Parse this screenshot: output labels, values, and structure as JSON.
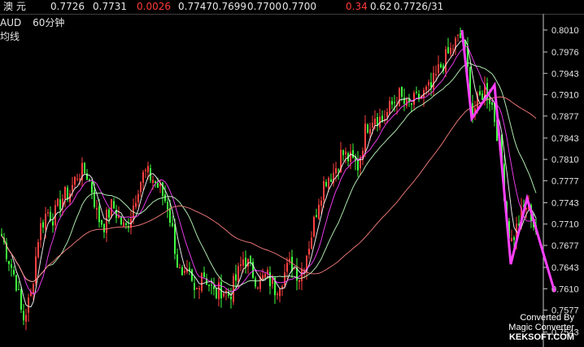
{
  "header": {
    "symbol": "澳  元",
    "quotes": [
      "0.7726",
      "0.7731",
      "0.0026",
      "0.7747",
      "0.7699",
      "0.7700",
      "0.7700",
      "0.34",
      "0.62",
      "0.7726/31"
    ]
  },
  "overlay": {
    "ticker": "AUD",
    "interval": "60分钟",
    "indicator": "均线"
  },
  "watermark": {
    "line1": "Converted By",
    "line2": "Magic Converter",
    "line3": "KEKSOFT.COM"
  },
  "chart_data": {
    "type": "candlestick",
    "y_ticks": [
      "0.8010",
      "0.7976",
      "0.7943",
      "0.7910",
      "0.7877",
      "0.7843",
      "0.7810",
      "0.7777",
      "0.7743",
      "0.7710",
      "0.7677",
      "0.7643",
      "0.7610",
      "0.7577",
      "0.7543"
    ],
    "ylim": [
      0.753,
      0.8025
    ],
    "colors": {
      "up": "#ff4040",
      "down": "#40ff40",
      "ma1": "#ffffff",
      "ma2": "#ff40ff",
      "ma3": "#c0ffc0",
      "ma4": "#ff8080",
      "zigzag": "#ff40ff"
    },
    "close_path": [
      [
        0,
        0.77
      ],
      [
        10,
        0.766
      ],
      [
        20,
        0.762
      ],
      [
        28,
        0.756
      ],
      [
        38,
        0.76
      ],
      [
        48,
        0.77
      ],
      [
        58,
        0.773
      ],
      [
        66,
        0.772
      ],
      [
        76,
        0.775
      ],
      [
        86,
        0.776
      ],
      [
        96,
        0.779
      ],
      [
        106,
        0.779
      ],
      [
        114,
        0.776
      ],
      [
        120,
        0.772
      ],
      [
        128,
        0.771
      ],
      [
        138,
        0.774
      ],
      [
        146,
        0.772
      ],
      [
        154,
        0.77
      ],
      [
        162,
        0.773
      ],
      [
        170,
        0.777
      ],
      [
        178,
        0.779
      ],
      [
        188,
        0.778
      ],
      [
        198,
        0.776
      ],
      [
        206,
        0.774
      ],
      [
        212,
        0.77
      ],
      [
        218,
        0.765
      ],
      [
        224,
        0.762
      ],
      [
        232,
        0.763
      ],
      [
        240,
        0.76
      ],
      [
        248,
        0.764
      ],
      [
        256,
        0.762
      ],
      [
        264,
        0.76
      ],
      [
        272,
        0.761
      ],
      [
        282,
        0.76
      ],
      [
        292,
        0.763
      ],
      [
        300,
        0.766
      ],
      [
        308,
        0.764
      ],
      [
        318,
        0.762
      ],
      [
        328,
        0.763
      ],
      [
        338,
        0.761
      ],
      [
        348,
        0.763
      ],
      [
        358,
        0.765
      ],
      [
        368,
        0.763
      ],
      [
        376,
        0.766
      ],
      [
        384,
        0.77
      ],
      [
        392,
        0.775
      ],
      [
        400,
        0.778
      ],
      [
        410,
        0.779
      ],
      [
        420,
        0.782
      ],
      [
        430,
        0.781
      ],
      [
        440,
        0.78
      ],
      [
        450,
        0.786
      ],
      [
        460,
        0.788
      ],
      [
        470,
        0.787
      ],
      [
        480,
        0.789
      ],
      [
        490,
        0.791
      ],
      [
        500,
        0.789
      ],
      [
        510,
        0.79
      ],
      [
        520,
        0.791
      ],
      [
        530,
        0.792
      ],
      [
        540,
        0.795
      ],
      [
        550,
        0.797
      ],
      [
        560,
        0.799
      ],
      [
        568,
        0.8
      ],
      [
        574,
        0.796
      ],
      [
        580,
        0.788
      ],
      [
        588,
        0.79
      ],
      [
        596,
        0.792
      ],
      [
        604,
        0.79
      ],
      [
        610,
        0.786
      ],
      [
        616,
        0.782
      ],
      [
        622,
        0.773
      ],
      [
        628,
        0.768
      ],
      [
        634,
        0.77
      ],
      [
        640,
        0.772
      ],
      [
        646,
        0.774
      ],
      [
        652,
        0.773
      ],
      [
        658,
        0.77
      ]
    ],
    "zigzag": [
      [
        568,
        0.801
      ],
      [
        580,
        0.7873
      ],
      [
        608,
        0.7925
      ],
      [
        628,
        0.7648
      ],
      [
        648,
        0.775
      ],
      [
        682,
        0.7605
      ]
    ],
    "ma_periods": [
      5,
      10,
      20,
      60
    ]
  }
}
